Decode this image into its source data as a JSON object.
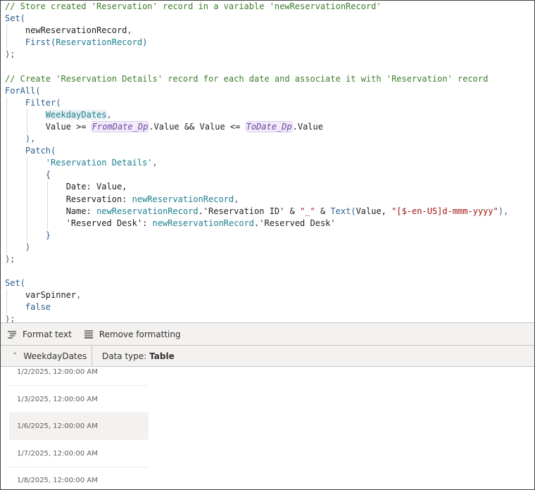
{
  "code_lines": [
    {
      "indent": 0,
      "tokens": [
        {
          "k": "comment",
          "t": "// Store created 'Reservation' record in a variable 'newReservationRecord'"
        }
      ]
    },
    {
      "indent": 0,
      "tokens": [
        {
          "k": "fn",
          "t": "Set("
        }
      ]
    },
    {
      "indent": 1,
      "tokens": [
        {
          "k": "plain",
          "t": "newReservationRecord"
        },
        {
          "k": "punct",
          "t": ","
        }
      ]
    },
    {
      "indent": 1,
      "tokens": [
        {
          "k": "fn",
          "t": "First("
        },
        {
          "k": "ident",
          "t": "ReservationRecord"
        },
        {
          "k": "fn",
          "t": ")"
        }
      ]
    },
    {
      "indent": 0,
      "tokens": [
        {
          "k": "punct",
          "t": ");"
        }
      ]
    },
    {
      "indent": 0,
      "tokens": []
    },
    {
      "indent": 0,
      "tokens": [
        {
          "k": "comment",
          "t": "// Create 'Reservation Details' record for each date and associate it with 'Reservation' record"
        }
      ]
    },
    {
      "indent": 0,
      "tokens": [
        {
          "k": "fn",
          "t": "ForAll("
        }
      ]
    },
    {
      "indent": 1,
      "tokens": [
        {
          "k": "fn",
          "t": "Filter("
        }
      ]
    },
    {
      "indent": 2,
      "tokens": [
        {
          "k": "ident-hl",
          "t": "WeekdayDates"
        },
        {
          "k": "punct",
          "t": ","
        }
      ]
    },
    {
      "indent": 2,
      "tokens": [
        {
          "k": "plain",
          "t": "Value >= "
        },
        {
          "k": "ctrl",
          "t": "FromDate_Dp"
        },
        {
          "k": "plain",
          "t": ".Value && Value <= "
        },
        {
          "k": "ctrl",
          "t": "ToDate_Dp"
        },
        {
          "k": "plain",
          "t": ".Value"
        }
      ]
    },
    {
      "indent": 1,
      "tokens": [
        {
          "k": "fn",
          "t": ")"
        },
        {
          "k": "punct",
          "t": ","
        }
      ]
    },
    {
      "indent": 1,
      "tokens": [
        {
          "k": "fn",
          "t": "Patch("
        }
      ]
    },
    {
      "indent": 2,
      "tokens": [
        {
          "k": "dsrc",
          "t": "'Reservation Details'"
        },
        {
          "k": "punct",
          "t": ","
        }
      ]
    },
    {
      "indent": 2,
      "tokens": [
        {
          "k": "fn",
          "t": "{"
        }
      ]
    },
    {
      "indent": 3,
      "tokens": [
        {
          "k": "plain",
          "t": "Date: Value,"
        }
      ]
    },
    {
      "indent": 3,
      "tokens": [
        {
          "k": "plain",
          "t": "Reservation: "
        },
        {
          "k": "ident",
          "t": "newReservationRecord"
        },
        {
          "k": "punct",
          "t": ","
        }
      ]
    },
    {
      "indent": 3,
      "tokens": [
        {
          "k": "plain",
          "t": "Name: "
        },
        {
          "k": "ident",
          "t": "newReservationRecord"
        },
        {
          "k": "plain",
          "t": ".'Reservation ID' & "
        },
        {
          "k": "str",
          "t": "\"_\""
        },
        {
          "k": "plain",
          "t": " & "
        },
        {
          "k": "fn",
          "t": "Text("
        },
        {
          "k": "plain",
          "t": "Value, "
        },
        {
          "k": "str",
          "t": "\"[$-en-US]d-mmm-yyyy\""
        },
        {
          "k": "fn",
          "t": ")"
        },
        {
          "k": "punct",
          "t": ","
        }
      ]
    },
    {
      "indent": 3,
      "tokens": [
        {
          "k": "plain",
          "t": "'Reserved Desk': "
        },
        {
          "k": "ident",
          "t": "newReservationRecord"
        },
        {
          "k": "plain",
          "t": ".'Reserved Desk'"
        }
      ]
    },
    {
      "indent": 2,
      "tokens": [
        {
          "k": "fn",
          "t": "}"
        }
      ]
    },
    {
      "indent": 1,
      "tokens": [
        {
          "k": "fn",
          "t": ")"
        }
      ]
    },
    {
      "indent": 0,
      "tokens": [
        {
          "k": "punct",
          "t": ");"
        }
      ]
    },
    {
      "indent": 0,
      "tokens": []
    },
    {
      "indent": 0,
      "tokens": [
        {
          "k": "fn",
          "t": "Set("
        }
      ]
    },
    {
      "indent": 1,
      "tokens": [
        {
          "k": "plain",
          "t": "varSpinner"
        },
        {
          "k": "punct",
          "t": ","
        }
      ]
    },
    {
      "indent": 1,
      "tokens": [
        {
          "k": "fn",
          "t": "false"
        }
      ]
    },
    {
      "indent": 0,
      "tokens": [
        {
          "k": "punct",
          "t": ");"
        }
      ]
    }
  ],
  "toolbar": {
    "format_text": "Format text",
    "remove_formatting": "Remove formatting"
  },
  "result_header": {
    "variable_name": "WeekdayDates",
    "data_type_label": "Data type:",
    "data_type_value": "Table"
  },
  "result_rows": [
    "1/2/2025, 12:00:00 AM",
    "1/3/2025, 12:00:00 AM",
    "1/6/2025, 12:00:00 AM",
    "1/7/2025, 12:00:00 AM",
    "1/8/2025, 12:00:00 AM"
  ],
  "selected_row_index": 2
}
